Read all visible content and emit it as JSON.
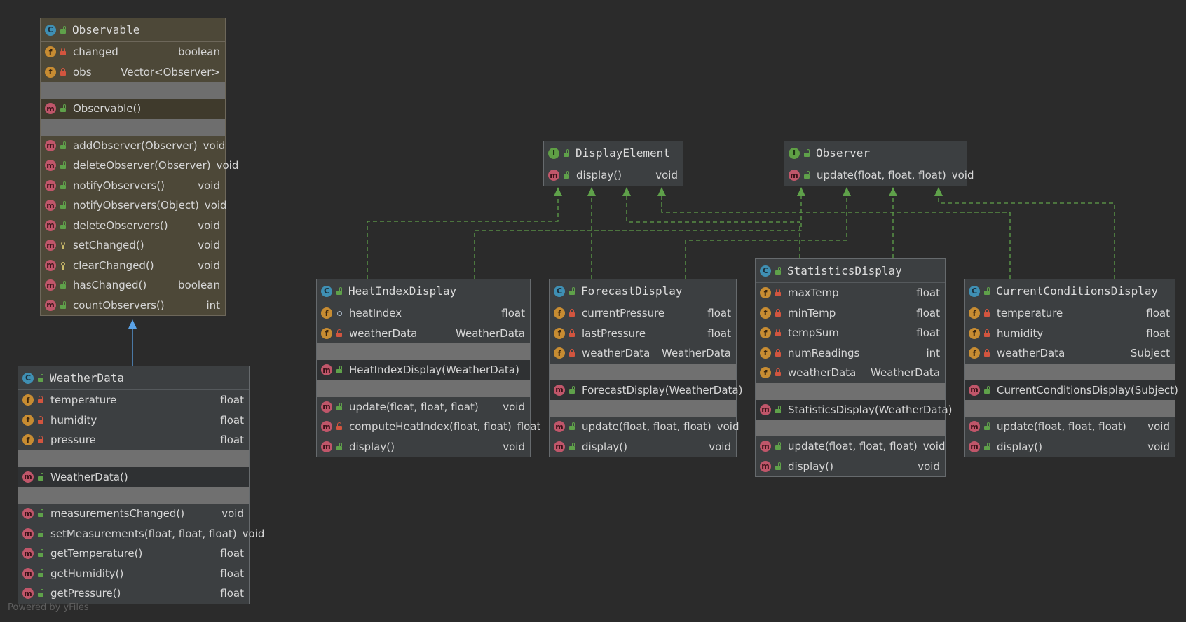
{
  "watermark": "Powered by yFiles",
  "colors": {
    "background": "#2b2b2b",
    "node": "#3c3f41",
    "abstract_node": "#4d4838",
    "realization_edge": "#5fa14a",
    "inheritance_edge": "#5aa2e6"
  },
  "classes": {
    "observable": {
      "kind": "C",
      "visibility": "public",
      "title": "Observable",
      "fields": [
        {
          "kind": "f",
          "vis": "private",
          "name": "changed",
          "type": "boolean"
        },
        {
          "kind": "f",
          "vis": "private",
          "name": "obs",
          "type": "Vector<Observer>"
        }
      ],
      "constructors": [
        {
          "kind": "m",
          "vis": "public",
          "name": "Observable()",
          "type": ""
        }
      ],
      "methods": [
        {
          "kind": "m",
          "vis": "public",
          "name": "addObserver(Observer)",
          "type": "void"
        },
        {
          "kind": "m",
          "vis": "public",
          "name": "deleteObserver(Observer)",
          "type": "void"
        },
        {
          "kind": "m",
          "vis": "public",
          "name": "notifyObservers()",
          "type": "void"
        },
        {
          "kind": "m",
          "vis": "public",
          "name": "notifyObservers(Object)",
          "type": "void"
        },
        {
          "kind": "m",
          "vis": "public",
          "name": "deleteObservers()",
          "type": "void"
        },
        {
          "kind": "m",
          "vis": "protected",
          "name": "setChanged()",
          "type": "void"
        },
        {
          "kind": "m",
          "vis": "protected",
          "name": "clearChanged()",
          "type": "void"
        },
        {
          "kind": "m",
          "vis": "public",
          "name": "hasChanged()",
          "type": "boolean"
        },
        {
          "kind": "m",
          "vis": "public",
          "name": "countObservers()",
          "type": "int"
        }
      ]
    },
    "weather_data": {
      "kind": "C",
      "visibility": "public",
      "title": "WeatherData",
      "fields": [
        {
          "kind": "f",
          "vis": "private",
          "name": "temperature",
          "type": "float"
        },
        {
          "kind": "f",
          "vis": "private",
          "name": "humidity",
          "type": "float"
        },
        {
          "kind": "f",
          "vis": "private",
          "name": "pressure",
          "type": "float"
        }
      ],
      "constructors": [
        {
          "kind": "m",
          "vis": "public",
          "name": "WeatherData()",
          "type": ""
        }
      ],
      "methods": [
        {
          "kind": "m",
          "vis": "public",
          "name": "measurementsChanged()",
          "type": "void"
        },
        {
          "kind": "m",
          "vis": "public",
          "name": "setMeasurements(float, float, float)",
          "type": "void"
        },
        {
          "kind": "m",
          "vis": "public",
          "name": "getTemperature()",
          "type": "float"
        },
        {
          "kind": "m",
          "vis": "public",
          "name": "getHumidity()",
          "type": "float"
        },
        {
          "kind": "m",
          "vis": "public",
          "name": "getPressure()",
          "type": "float"
        }
      ]
    },
    "display_element": {
      "kind": "I",
      "visibility": "public",
      "title": "DisplayElement",
      "fields": [],
      "constructors": [],
      "methods": [
        {
          "kind": "m",
          "vis": "public",
          "name": "display()",
          "type": "void"
        }
      ]
    },
    "observer": {
      "kind": "I",
      "visibility": "public",
      "title": "Observer",
      "fields": [],
      "constructors": [],
      "methods": [
        {
          "kind": "m",
          "vis": "public",
          "name": "update(float, float, float)",
          "type": "void"
        }
      ]
    },
    "heat_index_display": {
      "kind": "C",
      "visibility": "public",
      "title": "HeatIndexDisplay",
      "fields": [
        {
          "kind": "f",
          "vis": "package",
          "name": "heatIndex",
          "type": "float"
        },
        {
          "kind": "f",
          "vis": "private",
          "name": "weatherData",
          "type": "WeatherData"
        }
      ],
      "constructors": [
        {
          "kind": "m",
          "vis": "public",
          "name": "HeatIndexDisplay(WeatherData)",
          "type": ""
        }
      ],
      "methods": [
        {
          "kind": "m",
          "vis": "public",
          "name": "update(float, float, float)",
          "type": "void"
        },
        {
          "kind": "m",
          "vis": "private",
          "name": "computeHeatIndex(float, float)",
          "type": "float"
        },
        {
          "kind": "m",
          "vis": "public",
          "name": "display()",
          "type": "void"
        }
      ]
    },
    "forecast_display": {
      "kind": "C",
      "visibility": "public",
      "title": "ForecastDisplay",
      "fields": [
        {
          "kind": "f",
          "vis": "private",
          "name": "currentPressure",
          "type": "float"
        },
        {
          "kind": "f",
          "vis": "private",
          "name": "lastPressure",
          "type": "float"
        },
        {
          "kind": "f",
          "vis": "private",
          "name": "weatherData",
          "type": "WeatherData"
        }
      ],
      "constructors": [
        {
          "kind": "m",
          "vis": "public",
          "name": "ForecastDisplay(WeatherData)",
          "type": ""
        }
      ],
      "methods": [
        {
          "kind": "m",
          "vis": "public",
          "name": "update(float, float, float)",
          "type": "void"
        },
        {
          "kind": "m",
          "vis": "public",
          "name": "display()",
          "type": "void"
        }
      ]
    },
    "statistics_display": {
      "kind": "C",
      "visibility": "public",
      "title": "StatisticsDisplay",
      "fields": [
        {
          "kind": "f",
          "vis": "private",
          "name": "maxTemp",
          "type": "float"
        },
        {
          "kind": "f",
          "vis": "private",
          "name": "minTemp",
          "type": "float"
        },
        {
          "kind": "f",
          "vis": "private",
          "name": "tempSum",
          "type": "float"
        },
        {
          "kind": "f",
          "vis": "private",
          "name": "numReadings",
          "type": "int"
        },
        {
          "kind": "f",
          "vis": "private",
          "name": "weatherData",
          "type": "WeatherData"
        }
      ],
      "constructors": [
        {
          "kind": "m",
          "vis": "public",
          "name": "StatisticsDisplay(WeatherData)",
          "type": ""
        }
      ],
      "methods": [
        {
          "kind": "m",
          "vis": "public",
          "name": "update(float, float, float)",
          "type": "void"
        },
        {
          "kind": "m",
          "vis": "public",
          "name": "display()",
          "type": "void"
        }
      ]
    },
    "current_conditions_display": {
      "kind": "C",
      "visibility": "public",
      "title": "CurrentConditionsDisplay",
      "fields": [
        {
          "kind": "f",
          "vis": "private",
          "name": "temperature",
          "type": "float"
        },
        {
          "kind": "f",
          "vis": "private",
          "name": "humidity",
          "type": "float"
        },
        {
          "kind": "f",
          "vis": "private",
          "name": "weatherData",
          "type": "Subject"
        }
      ],
      "constructors": [
        {
          "kind": "m",
          "vis": "public",
          "name": "CurrentConditionsDisplay(Subject)",
          "type": ""
        }
      ],
      "methods": [
        {
          "kind": "m",
          "vis": "public",
          "name": "update(float, float, float)",
          "type": "void"
        },
        {
          "kind": "m",
          "vis": "public",
          "name": "display()",
          "type": "void"
        }
      ]
    }
  }
}
